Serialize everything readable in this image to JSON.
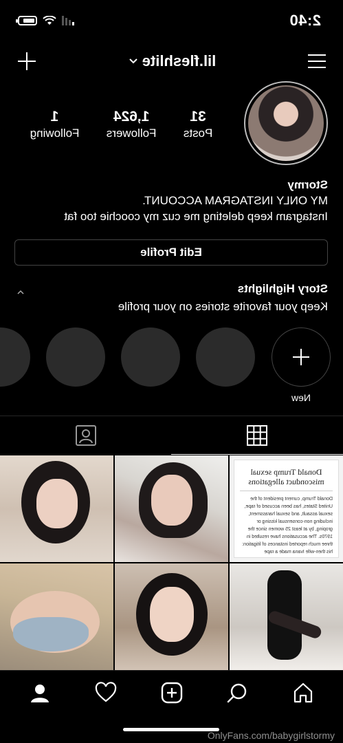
{
  "status_bar": {
    "time": "2:40"
  },
  "header": {
    "username": "lil.fleshlite"
  },
  "profile": {
    "stats": [
      {
        "value": "31",
        "label": "Posts"
      },
      {
        "value": "1,624",
        "label": "Followers"
      },
      {
        "value": "1",
        "label": "Following"
      }
    ],
    "name": "Stormy",
    "bio_lines": [
      "MY ONLY INSTAGRAM ACCOUNT.",
      "Instagram keep deleting me cuz my coochie too fat"
    ],
    "edit_profile_label": "Edit Profile"
  },
  "highlights": {
    "title": "Story Highlights",
    "subtitle": "Keep your favorite stories on your profile",
    "new_label": "New"
  },
  "posts": [
    {
      "kind": "photo"
    },
    {
      "kind": "screenshot",
      "title": "Donald Trump sexual misconduct allegations",
      "body_prefix": "Donald Trump, current president of the United States, has been accused of rape, sexual assault, and sexual harassment, including non-consensual kissing or groping, by at least 25 women since the 1970s. The accusations have resulted in three much reported instances of litigation: his then-wife Ivana made a rape"
    },
    {
      "kind": "photo"
    },
    {
      "kind": "photo"
    },
    {
      "kind": "photo"
    },
    {
      "kind": "photo"
    }
  ],
  "icons": {
    "menu": "hamburger-menu-icon",
    "add": "plus-icon",
    "chevron": "chevron-down-icon",
    "tab_grid": "grid-icon",
    "tab_tagged": "tagged-person-icon",
    "nav": [
      "home-icon",
      "search-icon",
      "add-post-icon",
      "heart-icon",
      "profile-icon"
    ]
  },
  "watermark": "OnlyFans.com/babygirlstormy",
  "colors": {
    "background": "#000000",
    "text": "#ffffff",
    "placeholder": "#2b2b2b"
  }
}
